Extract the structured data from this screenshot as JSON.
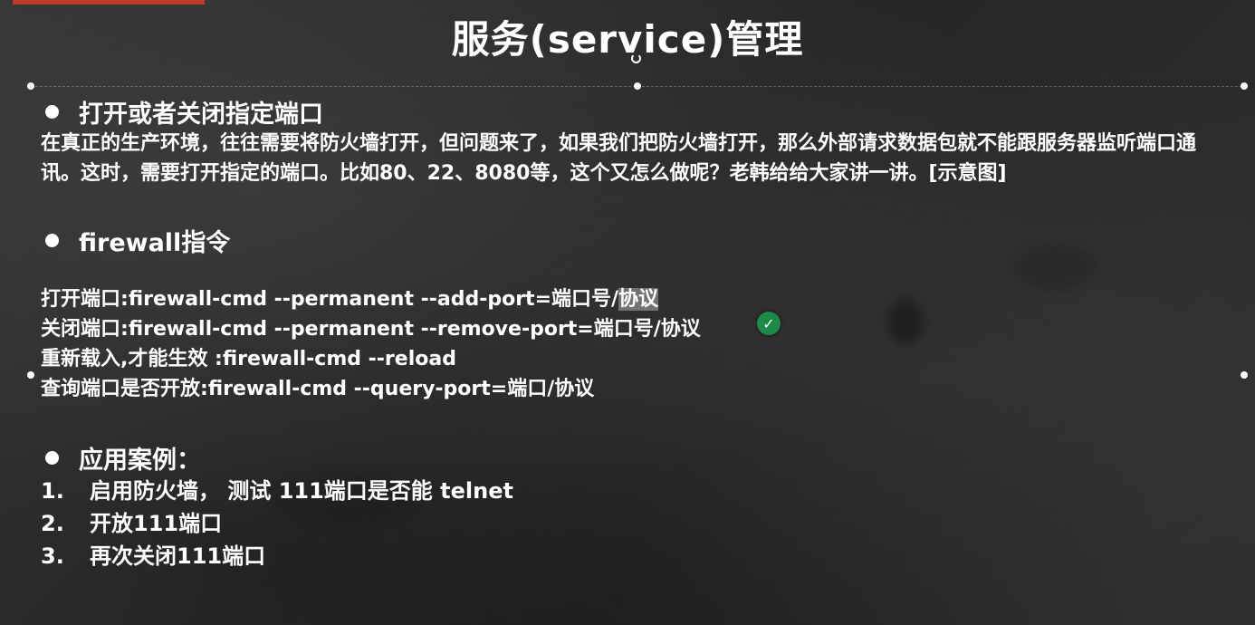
{
  "slide": {
    "title": "服务(service)管理",
    "section1": {
      "heading": "打开或者关闭指定端口",
      "paragraph": "在真正的生产环境，往往需要将防火墙打开，但问题来了，如果我们把防火墙打开，那么外部请求数据包就不能跟服务器监听端口通讯。这时，需要打开指定的端口。比如80、22、8080等，这个又怎么做呢？老韩给给大家讲一讲。[示意图]"
    },
    "section2": {
      "heading": "firewall指令",
      "commands": [
        {
          "label": "打开端口:   ",
          "text": "firewall-cmd --permanent --add-port=端口号/",
          "highlight": "协议"
        },
        {
          "label": "关闭端口:   ",
          "text": "firewall-cmd --permanent --remove-port=端口号/协议"
        },
        {
          "label": "重新载入,才能生效 : ",
          "text": "firewall-cmd --reload"
        },
        {
          "label": "查询端口是否开放:  ",
          "text": "firewall-cmd --query-port=端口/协议"
        }
      ]
    },
    "section3": {
      "heading": "应用案例：",
      "items": [
        {
          "num": "1.",
          "text": "启用防火墙， 测试 111端口是否能 telnet"
        },
        {
          "num": "2.",
          "text": "开放111端口"
        },
        {
          "num": "3.",
          "text": "再次关闭111端口"
        }
      ]
    }
  },
  "colors": {
    "background": "#2b2b2b",
    "text": "#ffffff",
    "accent_bar": "#c0392b",
    "cursor_badge": "#1e8a4a"
  },
  "icons": {
    "cursor_badge": "check-cursor-icon",
    "rotate_handle": "rotate-handle-icon"
  }
}
